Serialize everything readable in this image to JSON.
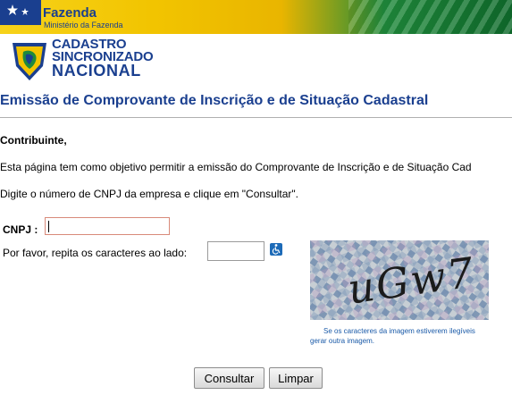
{
  "header": {
    "title": "Fazenda",
    "subtitle": "Ministério da Fazenda",
    "brand_blue": "#1a3f8f",
    "brand_yellow": "#f2c400",
    "brand_green": "#1f8a3b"
  },
  "logo": {
    "line1": "CADASTRO",
    "line2": "SINCRONIZADO",
    "line3": "NACIONAL",
    "icon": "brazil-shield-icon"
  },
  "page": {
    "title": "Emissão de Comprovante de Inscrição e de Situação Cadastral",
    "greeting": "Contribuinte,",
    "intro": "Esta página tem como objetivo permitir a emissão do Comprovante de Inscrição e de Situação Cad",
    "instruction": "Digite o número de CNPJ da empresa e clique em \"Consultar\"."
  },
  "form": {
    "cnpj_label": "CNPJ :",
    "cnpj_value": "",
    "captcha_label": "Por favor, repita os caracteres ao lado:",
    "captcha_value": "",
    "accessibility_icon": "wheelchair-icon",
    "captcha_image_text": "uGw7",
    "captcha_note_line1": "Se os caracteres da imagem estiverem ilegíveis",
    "captcha_note_line2": "gerar outra imagem.",
    "consultar_label": "Consultar",
    "limpar_label": "Limpar"
  }
}
